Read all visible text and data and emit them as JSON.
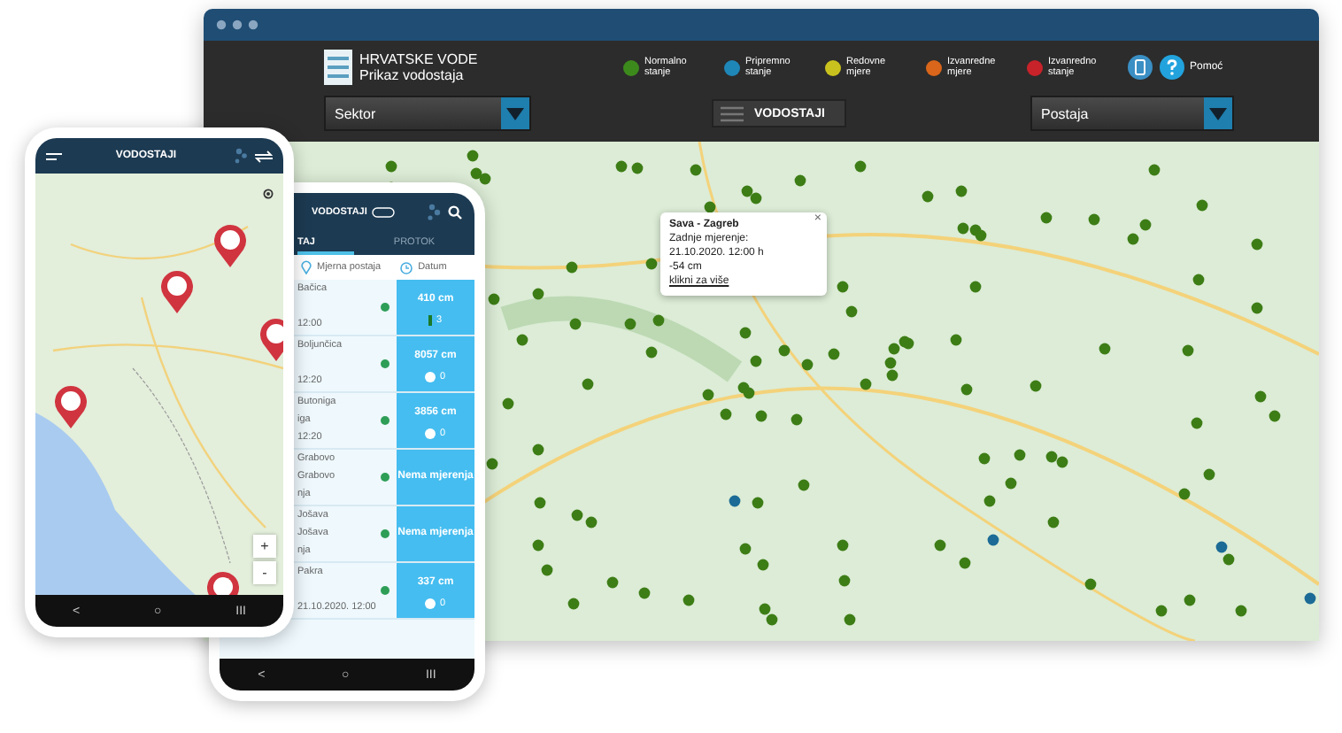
{
  "desktop": {
    "logo_lines": [
      "HRVATSKE VODE",
      "Prikaz vodostaja"
    ],
    "legend": [
      {
        "label": "Normalno stanje",
        "color": "#3d8a1c"
      },
      {
        "label": "Pripremno stanje",
        "color": "#1f86b8"
      },
      {
        "label": "Redovne mjere",
        "color": "#c9c21e"
      },
      {
        "label": "Izvanredne mjere",
        "color": "#d9661a"
      },
      {
        "label": "Izvanredno stanje",
        "color": "#c8222a"
      }
    ],
    "help": "Pomoć",
    "sector_select": "Sektor",
    "list_button": "VODOSTAJI",
    "station_select": "Postaja",
    "popup": {
      "title": "Sava - Zagreb",
      "lines": [
        "Zadnje mjerenje:",
        "21.10.2020. 12:00 h",
        "-54 cm"
      ],
      "link": "klikni za više",
      "close": "×"
    }
  },
  "phone_map": {
    "title": "VODOSTAJI",
    "zoom_in": "+",
    "zoom_out": "-",
    "nav": [
      "<",
      "○",
      "III"
    ]
  },
  "phone_list": {
    "title": "VODOSTAJI",
    "tabs": [
      {
        "label": "TAJ",
        "selected": true
      },
      {
        "label": "PROTOK",
        "selected": false
      }
    ],
    "columns": [
      "Mjerna postaja",
      "Datum"
    ],
    "rows": [
      {
        "name": "Bačica",
        "time": "12:00",
        "reading": "410 cm",
        "trend": {
          "kind": "bar",
          "value": "3"
        }
      },
      {
        "name": "Boljunčica",
        "time": "12:20",
        "reading": "8057 cm",
        "trend": {
          "kind": "dot",
          "value": "0"
        }
      },
      {
        "name": "Butoniga",
        "line_2": "iga",
        "time": "12:20",
        "reading": "3856 cm",
        "trend": {
          "kind": "dot",
          "value": "0"
        }
      },
      {
        "name": "Grabovo",
        "line_2": "Grabovo",
        "time": "nja",
        "reading": "Nema mjerenja"
      },
      {
        "name": "Jošava",
        "line_2": "Jošava",
        "time": "nja",
        "reading": "Nema mjerenja"
      },
      {
        "name": "Pakra",
        "time": "21.10.2020. 12:00",
        "reading": "337 cm",
        "trend": {
          "kind": "dot",
          "value": "0"
        }
      }
    ],
    "nav": [
      "<",
      "○",
      "III"
    ]
  }
}
